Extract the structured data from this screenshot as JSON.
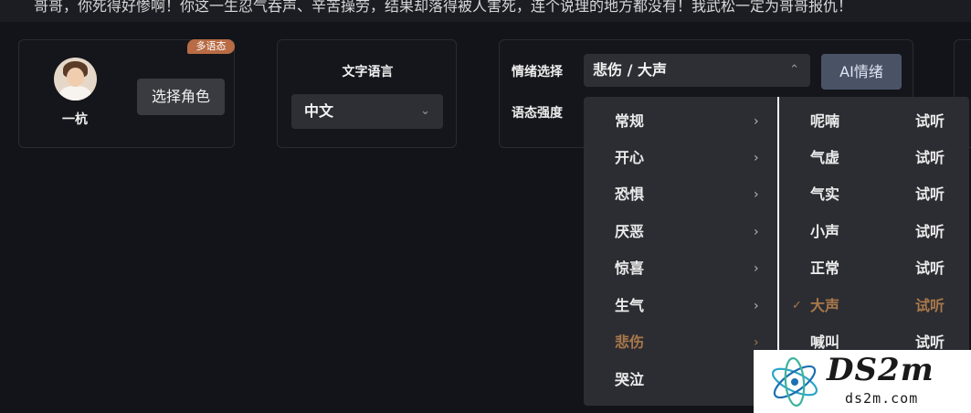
{
  "top_text": "哥哥，你死得好惨啊！你这一生忍气吞声、辛苦操劳，结果却落得被人害死，连个说理的地方都没有！我武松一定为哥哥报仇！",
  "role_panel": {
    "badge": "多语态",
    "name": "一杭",
    "select_button": "选择角色"
  },
  "lang_panel": {
    "label": "文字语言",
    "value": "中文"
  },
  "emotion_panel": {
    "emotion_label": "情绪选择",
    "emotion_value": "悲伤 / 大声",
    "ai_button": "AI情绪",
    "intensity_label": "语态强度"
  },
  "dropdown": {
    "categories": [
      {
        "label": "常规",
        "active": false
      },
      {
        "label": "开心",
        "active": false
      },
      {
        "label": "恐惧",
        "active": false
      },
      {
        "label": "厌恶",
        "active": false
      },
      {
        "label": "惊喜",
        "active": false
      },
      {
        "label": "生气",
        "active": false
      },
      {
        "label": "悲伤",
        "active": true
      },
      {
        "label": "哭泣",
        "active": false
      }
    ],
    "options": [
      {
        "label": "呢喃",
        "play": "试听",
        "selected": false
      },
      {
        "label": "气虚",
        "play": "试听",
        "selected": false
      },
      {
        "label": "气实",
        "play": "试听",
        "selected": false
      },
      {
        "label": "小声",
        "play": "试听",
        "selected": false
      },
      {
        "label": "正常",
        "play": "试听",
        "selected": false
      },
      {
        "label": "大声",
        "play": "试听",
        "selected": true
      },
      {
        "label": "喊叫",
        "play": "试听",
        "selected": false
      }
    ]
  },
  "watermark": {
    "main": "DS2m",
    "sub": "ds2m.com"
  },
  "colors": {
    "background": "#131419",
    "accent": "#a9784b",
    "badge": "#b86b44",
    "ai_button": "#4a5366"
  },
  "icons": {
    "chevron_down": "chevron-down-icon",
    "chevron_up": "chevron-up-icon",
    "chevron_right": "chevron-right-icon",
    "check": "check-icon"
  }
}
